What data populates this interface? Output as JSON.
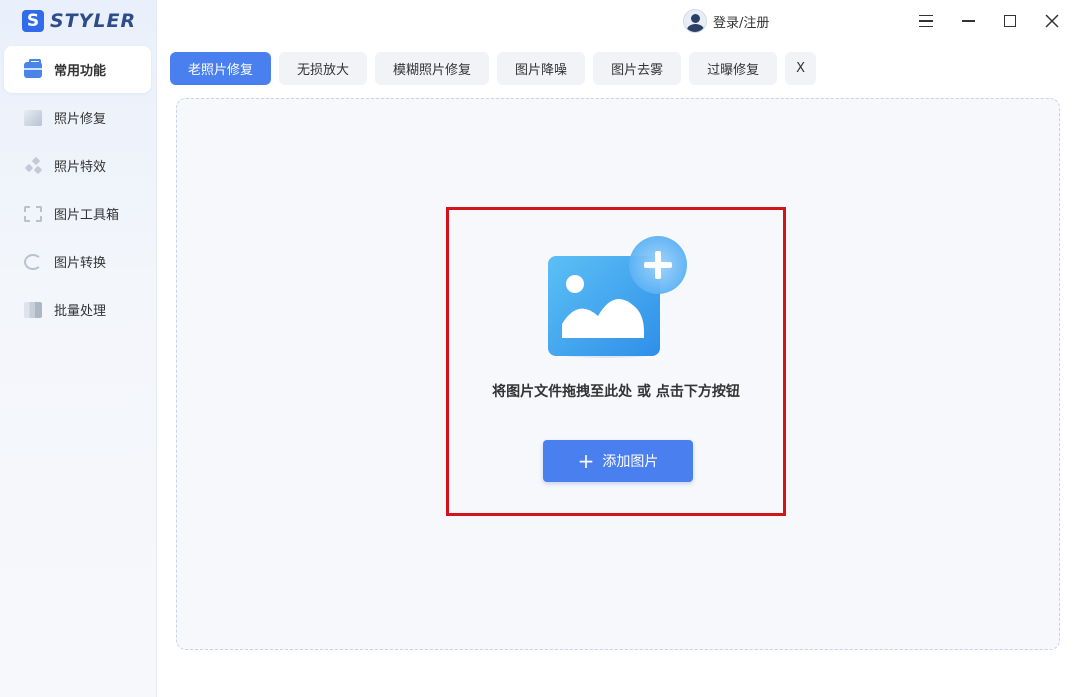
{
  "app": {
    "logo_letter": "S",
    "name": "STYLER"
  },
  "header": {
    "login_label": "登录/注册"
  },
  "sidebar": {
    "items": [
      {
        "label": "常用功能",
        "icon": "briefcase-icon"
      },
      {
        "label": "照片修复",
        "icon": "photo-icon"
      },
      {
        "label": "照片特效",
        "icon": "sparkle-icon"
      },
      {
        "label": "图片工具箱",
        "icon": "toolbox-icon"
      },
      {
        "label": "图片转换",
        "icon": "convert-icon"
      },
      {
        "label": "批量处理",
        "icon": "batch-icon"
      }
    ]
  },
  "tabs": [
    {
      "label": "老照片修复"
    },
    {
      "label": "无损放大"
    },
    {
      "label": "模糊照片修复"
    },
    {
      "label": "图片降噪"
    },
    {
      "label": "图片去雾"
    },
    {
      "label": "过曝修复"
    },
    {
      "label": "X"
    }
  ],
  "dropzone": {
    "hint": "将图片文件拖拽至此处 或 点击下方按钮",
    "add_button": "添加图片"
  },
  "colors": {
    "accent": "#4a7ff0",
    "highlight_border": "#d4141d"
  }
}
